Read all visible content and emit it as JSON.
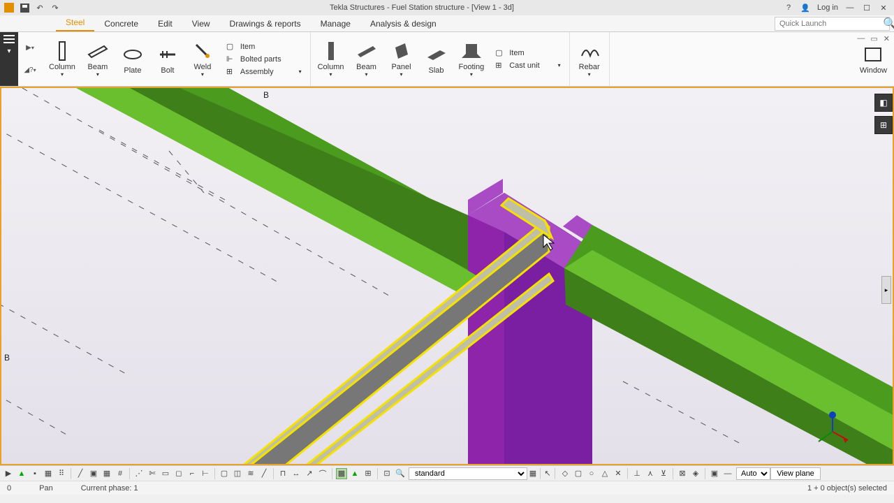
{
  "title": "Tekla Structures - Fuel Station structure - [View 1 - 3d]",
  "titlebar": {
    "login": "Log in"
  },
  "menu": {
    "tabs": [
      "Steel",
      "Concrete",
      "Edit",
      "View",
      "Drawings & reports",
      "Manage",
      "Analysis & design"
    ],
    "active": 0,
    "quick_placeholder": "Quick Launch"
  },
  "ribbon": {
    "steel": {
      "column": "Column",
      "beam": "Beam",
      "plate": "Plate",
      "bolt": "Bolt",
      "weld": "Weld",
      "item": "Item",
      "bolted": "Bolted parts",
      "assembly": "Assembly"
    },
    "concrete": {
      "column": "Column",
      "beam": "Beam",
      "panel": "Panel",
      "slab": "Slab",
      "footing": "Footing",
      "item": "Item",
      "cast": "Cast unit"
    },
    "other": {
      "rebar": "Rebar",
      "window": "Window"
    }
  },
  "bottom": {
    "select_value": "standard",
    "auto": "Auto",
    "viewplane": "View plane"
  },
  "status": {
    "coord": "0",
    "mode": "Pan",
    "phase": "Current phase: 1",
    "sel": "1 + 0 object(s) selected"
  },
  "viewport": {
    "labels": {
      "b1": "B",
      "b2": "B"
    },
    "colors": {
      "beam": "#4b9b1f",
      "beam_top": "#6abf2e",
      "column": "#8e24aa",
      "column_top": "#a84bc4",
      "selected_fill": "#bfbfa8",
      "selected_edge": "#f5e100",
      "grid": "#555"
    }
  }
}
